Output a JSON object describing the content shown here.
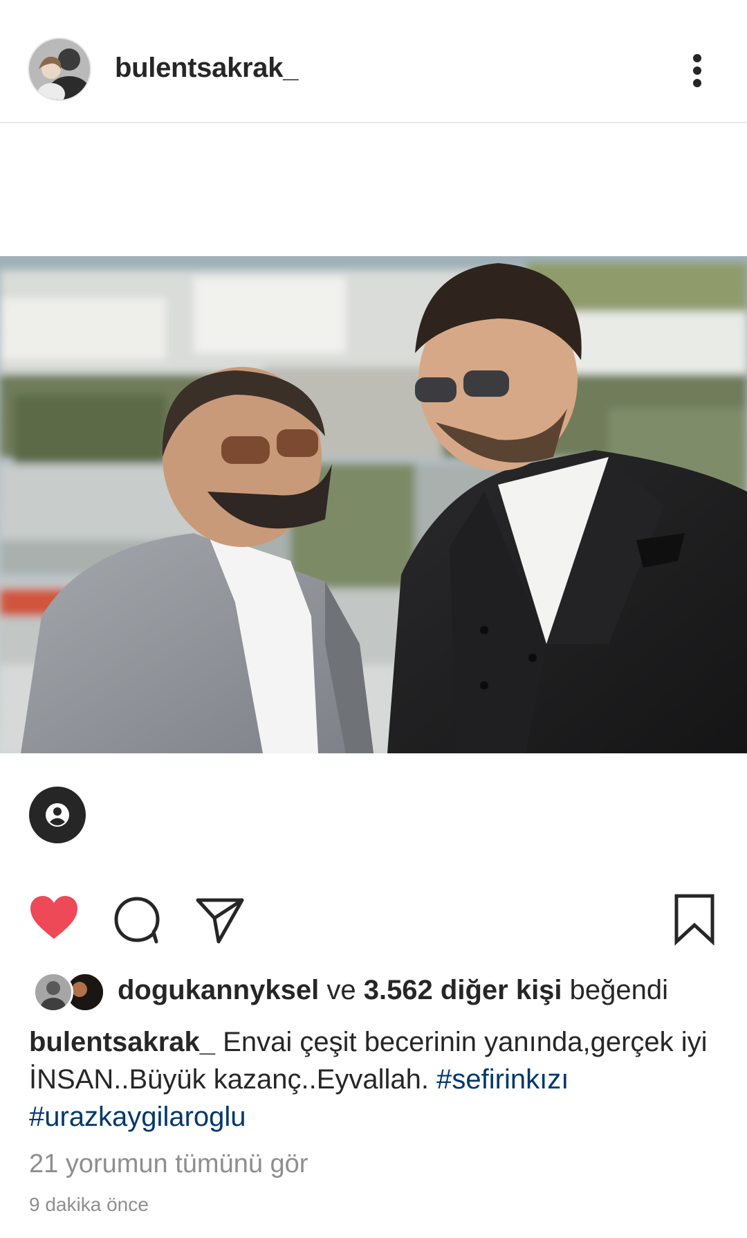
{
  "post": {
    "username": "bulentsakrak_",
    "profile_avatar": "profile-photo",
    "photo": "two-men-in-suits-photo",
    "liked": true
  },
  "likes": {
    "first_liker": "dogukannyksel",
    "connector": "ve",
    "others_count": "3.562 diğer kişi",
    "suffix": "beğendi"
  },
  "caption": {
    "username": "bulentsakrak_",
    "text": "Envai çeşit becerinin yanında,gerçek iyi İNSAN..Büyük kazanç..Eyvallah.",
    "hashtags": [
      "#sefirinkızı",
      "#urazkaygilaroglu"
    ]
  },
  "comments_link": "21 yorumun tümünü gör",
  "timestamp": "9 dakika önce",
  "icons": {
    "more": "more-vertical-icon",
    "tag": "user-tag-icon",
    "like": "heart-filled-icon",
    "comment": "comment-icon",
    "share": "send-icon",
    "save": "bookmark-icon"
  },
  "colors": {
    "like_red": "#ed4956",
    "text": "#262626",
    "secondary": "#8e8e8e",
    "hashtag": "#00376b"
  }
}
